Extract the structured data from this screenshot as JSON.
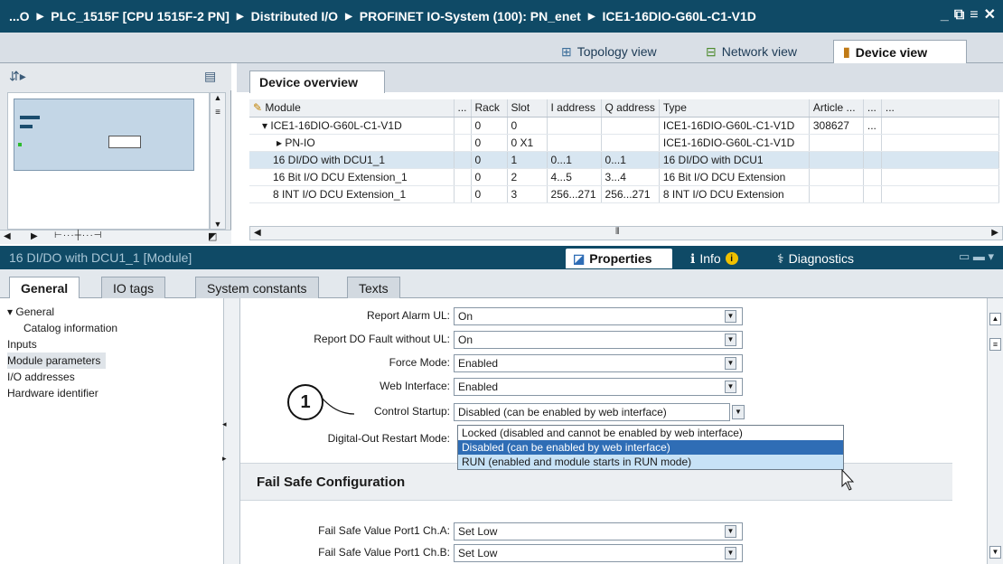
{
  "title_bar": {
    "crumbs": [
      "...O",
      "PLC_1515F [CPU 1515F-2 PN]",
      "Distributed I/O",
      "PROFINET IO-System (100): PN_enet",
      "ICE1-16DIO-G60L-C1-V1D"
    ],
    "controls": [
      "_",
      "⧉",
      "≡",
      "✕"
    ]
  },
  "view_tabs": {
    "topology": "Topology view",
    "network": "Network view",
    "device": "Device view"
  },
  "device_overview": {
    "tab_label": "Device overview",
    "columns": [
      "Module",
      "...",
      "Rack",
      "Slot",
      "I address",
      "Q address",
      "Type",
      "Article ...",
      "...",
      "..."
    ],
    "rows": [
      {
        "module": "ICE1-16DIO-G60L-C1-V1D",
        "rack": "0",
        "slot": "0",
        "iaddr": "",
        "qaddr": "",
        "type": "ICE1-16DIO-G60L-C1-V1D",
        "article": "308627",
        "extra": "..."
      },
      {
        "module": "PN-IO",
        "rack": "0",
        "slot": "0 X1",
        "iaddr": "",
        "qaddr": "",
        "type": "ICE1-16DIO-G60L-C1-V1D",
        "article": "",
        "extra": ""
      },
      {
        "module": "16 DI/DO with DCU1_1",
        "rack": "0",
        "slot": "1",
        "iaddr": "0...1",
        "qaddr": "0...1",
        "type": "16 DI/DO with DCU1",
        "article": "",
        "extra": ""
      },
      {
        "module": "16 Bit I/O DCU Extension_1",
        "rack": "0",
        "slot": "2",
        "iaddr": "4...5",
        "qaddr": "3...4",
        "type": "16 Bit I/O DCU Extension",
        "article": "",
        "extra": ""
      },
      {
        "module": "8 INT I/O DCU Extension_1",
        "rack": "0",
        "slot": "3",
        "iaddr": "256...271",
        "qaddr": "256...271",
        "type": "8 INT I/O DCU Extension",
        "article": "",
        "extra": ""
      }
    ]
  },
  "properties_bar": {
    "title": "16 DI/DO with DCU1_1 [Module]",
    "properties": "Properties",
    "info": "Info",
    "diagnostics": "Diagnostics"
  },
  "inspector_tabs": [
    "General",
    "IO tags",
    "System constants",
    "Texts"
  ],
  "nav": [
    {
      "label": "▾ General",
      "indent": 0
    },
    {
      "label": "Catalog information",
      "indent": 1
    },
    {
      "label": "Inputs",
      "indent": 0
    },
    {
      "label": "Module parameters",
      "indent": 0
    },
    {
      "label": "I/O addresses",
      "indent": 0
    },
    {
      "label": "Hardware identifier",
      "indent": 0
    }
  ],
  "params": {
    "report_alarm_ul": {
      "label": "Report Alarm UL:",
      "value": "On"
    },
    "report_do_fault": {
      "label": "Report DO Fault without UL:",
      "value": "On"
    },
    "force_mode": {
      "label": "Force Mode:",
      "value": "Enabled"
    },
    "web_interface": {
      "label": "Web Interface:",
      "value": "Enabled"
    },
    "control_startup": {
      "label": "Control Startup:",
      "value": "Disabled (can be enabled by web interface)"
    },
    "do_restart": {
      "label": "Digital-Out Restart Mode:"
    }
  },
  "dropdown_options": [
    "Locked (disabled and cannot be enabled by web interface)",
    "Disabled (can be enabled by web interface)",
    "RUN (enabled and module starts in RUN mode)"
  ],
  "fail_safe": {
    "title": "Fail Safe Configuration",
    "port1_a": {
      "label": "Fail Safe Value Port1 Ch.A:",
      "value": "Set Low"
    },
    "port1_b": {
      "label": "Fail Safe Value Port1 Ch.B:",
      "value": "Set Low"
    }
  },
  "callout": "1",
  "colors": {
    "title_bg": "#0f4a66",
    "selection": "#2f6db5",
    "hover": "#c7e2f6"
  }
}
